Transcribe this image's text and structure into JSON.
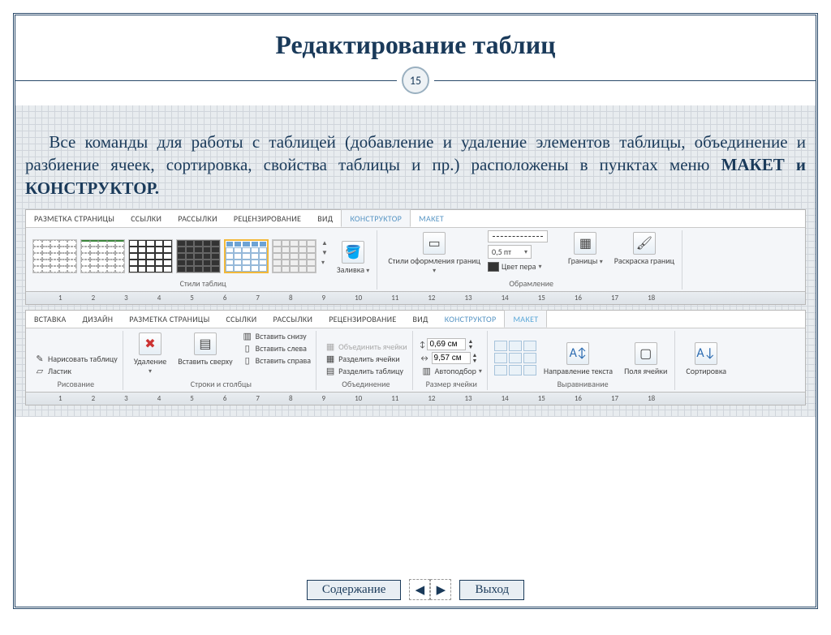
{
  "slide": {
    "title": "Редактирование таблиц",
    "page_number": "15",
    "body_text_1": "Все команды для работы с таблицей (добавление и удаление элементов таблицы, объединение и разбиение ячеек,  сортировка,  свойства таблицы и пр.) расположены в пунктах меню ",
    "body_bold": "МАКЕТ и КОНСТРУКТОР."
  },
  "ribbon1": {
    "tabs": [
      "РАЗМЕТКА СТРАНИЦЫ",
      "ССЫЛКИ",
      "РАССЫЛКИ",
      "РЕЦЕНЗИРОВАНИЕ",
      "ВИД",
      "КОНСТРУКТОР",
      "МАКЕТ"
    ],
    "group_styles": "Стили таблиц",
    "fill_button": "Заливка",
    "border_styles_button": "Стили оформления границ",
    "pt_value": "0,5 пт",
    "pen_color": "Цвет пера",
    "group_border": "Обрамление",
    "borders_button": "Границы",
    "paint_button": "Раскраска границ",
    "ruler_marks": [
      "1",
      "2",
      "3",
      "4",
      "5",
      "6",
      "7",
      "8",
      "9",
      "10",
      "11",
      "12",
      "13",
      "14",
      "15",
      "16",
      "17",
      "18"
    ]
  },
  "ribbon2": {
    "tabs": [
      "ВСТАВКА",
      "ДИЗАЙН",
      "РАЗМЕТКА СТРАНИЦЫ",
      "ССЫЛКИ",
      "РАССЫЛКИ",
      "РЕЦЕНЗИРОВАНИЕ",
      "ВИД",
      "КОНСТРУКТОР",
      "МАКЕТ"
    ],
    "draw_table": "Нарисовать таблицу",
    "eraser": "Ластик",
    "group_draw": "Рисование",
    "delete_button": "Удаление",
    "insert_above": "Вставить сверху",
    "insert_below": "Вставить снизу",
    "insert_left": "Вставить слева",
    "insert_right": "Вставить справа",
    "group_rowscols": "Строки и столбцы",
    "merge_cells": "Объединить ячейки",
    "split_cells": "Разделить ячейки",
    "split_table": "Разделить таблицу",
    "group_merge": "Объединение",
    "height_val": "0,69 см",
    "width_val": "9,57 см",
    "autofit": "Автоподбор",
    "group_cellsize": "Размер ячейки",
    "text_dir": "Направление текста",
    "cell_margins": "Поля ячейки",
    "group_align": "Выравнивание",
    "sort_button": "Сортировка"
  },
  "footer": {
    "contents_button": "Содержание",
    "exit_button": "Выход"
  }
}
